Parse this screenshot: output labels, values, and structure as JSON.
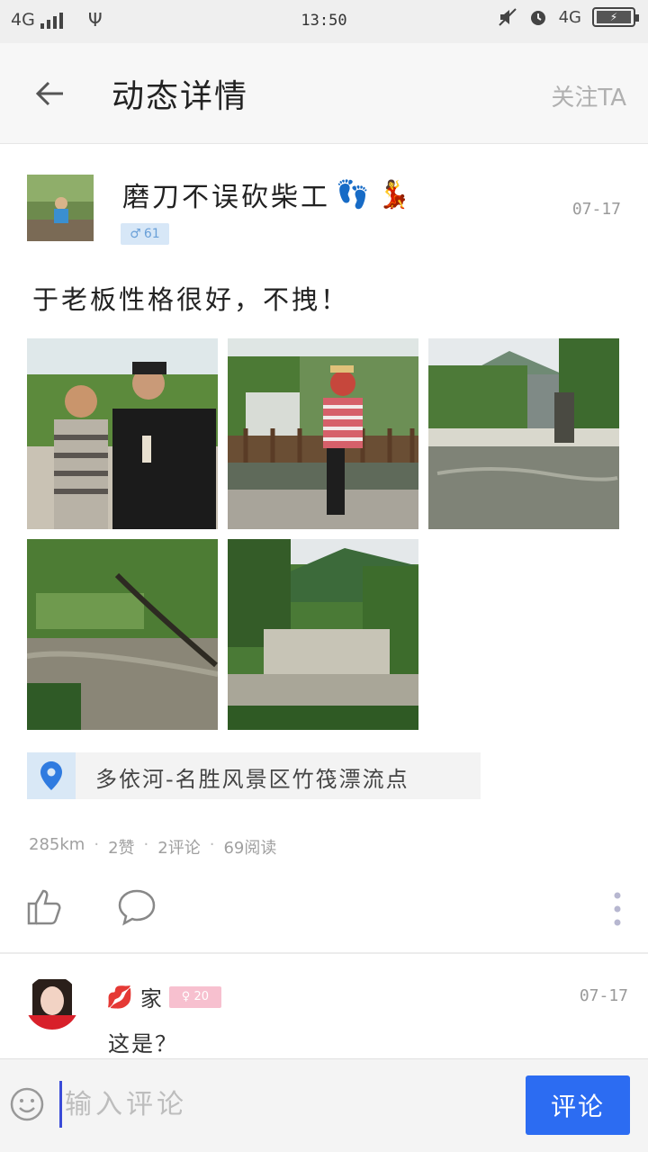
{
  "status_bar": {
    "network": "4G",
    "time": "13:50",
    "network_right": "4G",
    "icons": [
      "signal-icon",
      "usb-icon",
      "mute-icon",
      "alarm-icon",
      "battery-icon"
    ]
  },
  "header": {
    "title": "动态详情",
    "follow_label": "关注TA"
  },
  "post": {
    "username": "磨刀不误砍柴工",
    "user_emojis": [
      "👣",
      "💃"
    ],
    "gender_symbol": "♂",
    "age": "61",
    "date": "07-17",
    "text": "于老板性格很好，不拽！",
    "photos": [
      {
        "alt": "two men posing"
      },
      {
        "alt": "woman by railing"
      },
      {
        "alt": "river rapids"
      },
      {
        "alt": "riverside trees"
      },
      {
        "alt": "valley stream"
      }
    ],
    "location": "多依河-名胜风景区竹筏漂流点",
    "stats": {
      "distance": "285km",
      "likes": "2赞",
      "comments": "2评论",
      "reads": "69阅读"
    }
  },
  "comment": {
    "name_emoji": "💋",
    "name": "家",
    "gender_symbol": "♀",
    "age": "20",
    "date": "07-17",
    "text": "这是？"
  },
  "input_bar": {
    "placeholder": "输入评论",
    "submit_label": "评论"
  },
  "colors": {
    "accent": "#2c6cf2",
    "male_badge": "#d7e7f7",
    "female_badge": "#f7c0cf"
  }
}
